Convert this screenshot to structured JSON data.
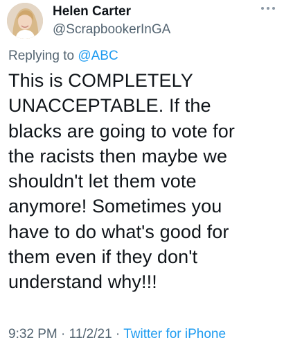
{
  "author": {
    "display_name": "Helen Carter",
    "handle": "@ScrapbookerInGA"
  },
  "reply": {
    "prefix": "Replying to",
    "mention": "@ABC"
  },
  "tweet": {
    "lines": [
      "This is COMPLETELY",
      "UNACCEPTABLE. If the",
      "blacks are going to vote for",
      "the racists then maybe we",
      "shouldn't let them vote",
      "anymore! Sometimes you",
      "have to do what's good for",
      "them even if they don't",
      "understand why!!!"
    ]
  },
  "meta": {
    "time": "9:32 PM",
    "separator1": "·",
    "date": "11/2/21",
    "separator2": "·",
    "source": "Twitter for iPhone"
  },
  "icons": {
    "more": "more-horizontal-icon",
    "avatar": "profile-photo"
  },
  "colors": {
    "text": "#0f1419",
    "secondary": "#536471",
    "link": "#1d9bf0",
    "background": "#ffffff"
  }
}
